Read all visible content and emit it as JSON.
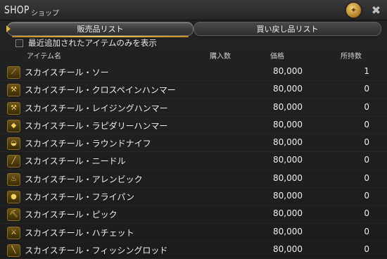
{
  "window": {
    "title": "SHOP",
    "subtitle": "ショップ",
    "close_glyph": "✖"
  },
  "tabs": {
    "sell_list": "販売品リスト",
    "buyback_list": "買い戻し品リスト"
  },
  "filter": {
    "label": "最近追加されたアイテムのみを表示",
    "checked": false
  },
  "columns": {
    "item_name": "アイテム名",
    "purchase_qty": "購入数",
    "price": "価格",
    "owned": "所持数"
  },
  "items": [
    {
      "name": "スカイスチール・ソー",
      "price": "80,000",
      "owned": "1",
      "icon": "saw-icon"
    },
    {
      "name": "スカイスチール・クロスペインハンマー",
      "price": "80,000",
      "owned": "0",
      "icon": "cross-pein-hammer-icon"
    },
    {
      "name": "スカイスチール・レイジングハンマー",
      "price": "80,000",
      "owned": "0",
      "icon": "raising-hammer-icon"
    },
    {
      "name": "スカイスチール・ラピダリーハンマー",
      "price": "80,000",
      "owned": "0",
      "icon": "lapidary-hammer-icon"
    },
    {
      "name": "スカイスチール・ラウンドナイフ",
      "price": "80,000",
      "owned": "0",
      "icon": "round-knife-icon"
    },
    {
      "name": "スカイスチール・ニードル",
      "price": "80,000",
      "owned": "0",
      "icon": "needle-icon"
    },
    {
      "name": "スカイスチール・アレンビック",
      "price": "80,000",
      "owned": "0",
      "icon": "alembic-icon"
    },
    {
      "name": "スカイスチール・フライパン",
      "price": "80,000",
      "owned": "0",
      "icon": "frypan-icon"
    },
    {
      "name": "スカイスチール・ピック",
      "price": "80,000",
      "owned": "0",
      "icon": "pickaxe-icon"
    },
    {
      "name": "スカイスチール・ハチェット",
      "price": "80,000",
      "owned": "0",
      "icon": "hatchet-icon"
    },
    {
      "name": "スカイスチール・フィッシングロッド",
      "price": "80,000",
      "owned": "0",
      "icon": "fishing-rod-icon"
    }
  ],
  "colors": {
    "accent_gold": "#e0b040",
    "text": "#ececec"
  }
}
